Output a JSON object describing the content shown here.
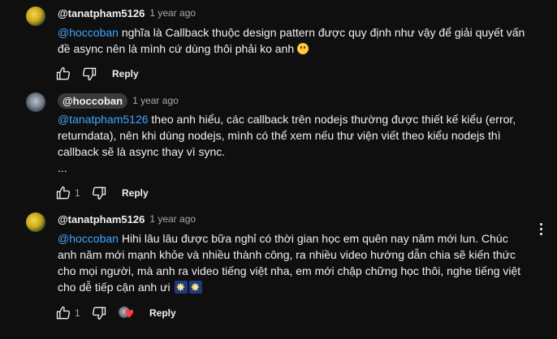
{
  "comments": [
    {
      "handle": "@tanatpham5126",
      "time": "1 year ago",
      "mention": "@hoccoban",
      "line1": " nghĩa là Callback thuộc design pattern được quy định như vậy để giải quyết vấn",
      "line2": "đề async nên là mình cứ dùng thôi phải ko anh ",
      "emoji": "slightly-smiling-face",
      "reply_label": "Reply"
    },
    {
      "handle": "@hoccoban",
      "time": "1 year ago",
      "mention": "@tanatpham5126",
      "line1": " theo anh hiểu, các callback trên nodejs thường được thiết kế kiểu (error,",
      "line2": "returndata), nên khi dùng nodejs, mình có thể xem nếu thư viện viết theo kiểu nodejs thì",
      "line3": "callback sẽ là async thay vì sync.",
      "line4": "...",
      "like_count": "1",
      "reply_label": "Reply"
    },
    {
      "handle": "@tanatpham5126",
      "time": "1 year ago",
      "mention": "@hoccoban",
      "line1": " Hihi lâu lâu được bữa nghỉ có thời gian học em quên nay năm mới lun. Chúc",
      "line2": "anh năm mới mạnh khỏe và nhiều thành công, ra nhiều video hướng dẫn chia sẽ kiến thức",
      "line3": "cho mọi người, mà anh ra video tiếng việt nha, em mới chập chững học thôi, nghe tiếng việt",
      "line4": "cho dễ tiếp cận anh ưi ",
      "emojis": [
        "fireworks",
        "fireworks"
      ],
      "like_count": "1",
      "reply_label": "Reply"
    }
  ],
  "colors": {
    "background": "#0f0f0f",
    "text": "#f1f1f1",
    "secondary_text": "#aaaaaa",
    "mention": "#3ea6ff",
    "chip": "#3a3a3a",
    "heart": "#ff3b3b"
  }
}
